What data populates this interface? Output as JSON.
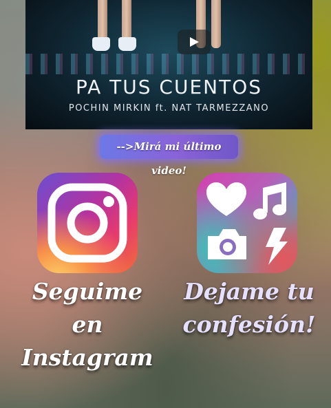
{
  "video": {
    "title": "PA TUS CUENTOS",
    "artists": "POCHIN MIRKIN ft. NAT TARMEZZANO"
  },
  "cta_button": {
    "label": "-->Mirá mi último video!"
  },
  "links": [
    {
      "label_line1": "Seguime en",
      "label_line2": "Instagram",
      "icon": "instagram-icon"
    },
    {
      "label_line1": "Dejame tu",
      "label_line2": "confesión!",
      "icon": "confession-icons"
    }
  ],
  "colors": {
    "cta_gradient_start": "#6c78e6",
    "cta_gradient_end": "#7057c8",
    "label_instagram": "#ffffff",
    "label_confession": "#e6e0ff"
  }
}
